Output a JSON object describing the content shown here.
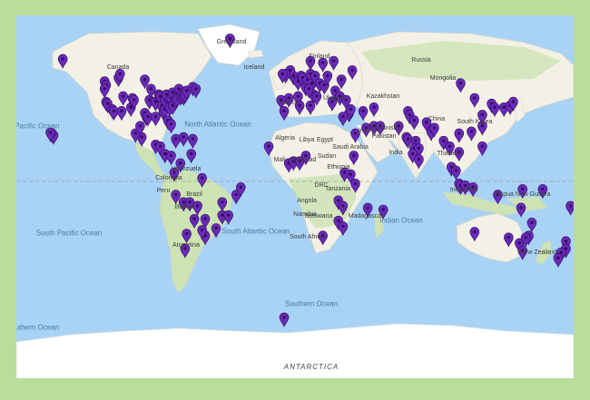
{
  "colors": {
    "frame": "#b9de9a",
    "water": "#a9d3f5",
    "land": "#f3f0e6",
    "green": "#cde3b4",
    "ice": "#ffffff",
    "marker": "#6a29b8"
  },
  "labels": {
    "north_atlantic_ocean": "North Atlantic Ocean",
    "south_atlantic_ocean": "South Atlantic Ocean",
    "north_pacific_ocean": "North Pacific Ocean",
    "south_pacific_ocean": "South Pacific Ocean",
    "indian_ocean": "Indian Ocean",
    "southern_ocean": "Southern Ocean",
    "southern_ocean_left": "Southern Ocean",
    "antarctica": "ANTARCTICA",
    "canada": "Canada",
    "greenland": "Greenland",
    "iceland": "Iceland",
    "finland": "Finland",
    "russia": "Russia",
    "mongolia": "Mongolia",
    "china": "China",
    "south_korea": "South Korea",
    "kazakhstan": "Kazakhstan",
    "ukraine": "Ukraine",
    "france": "France",
    "iran": "Iran",
    "afghanistan": "Afghanistan",
    "pakistan": "Pakistan",
    "india": "India",
    "saudi_arabia": "Saudi Arabia",
    "algeria": "Algeria",
    "libya": "Libya",
    "egypt": "Egypt",
    "mali": "Mali",
    "niger": "Niger",
    "chad": "Chad",
    "sudan": "Sudan",
    "ethiopia": "Ethiopia",
    "drc": "DRC",
    "tanzania": "Tanzania",
    "angola": "Angola",
    "namibia": "Namibia",
    "botswana": "Botswana",
    "south_africa": "South Africa",
    "madagascar": "Madagascar",
    "venezuela": "Venezuela",
    "colombia": "Colombia",
    "peru": "Peru",
    "brazil": "Brazil",
    "bolivia": "Bolivia",
    "argentina": "Argentina",
    "thailand": "Thailand",
    "indonesia": "Indonesia",
    "papua_new_guinea": "Papua New Guinea",
    "new_zealand": "New Zealand"
  },
  "markers": [
    {
      "lon": -150,
      "lat": 61
    },
    {
      "lon": -42,
      "lat": 72
    },
    {
      "lon": -157,
      "lat": 21
    },
    {
      "lon": -156,
      "lat": 20
    },
    {
      "lon": -158,
      "lat": 21.5
    },
    {
      "lon": -123,
      "lat": 49
    },
    {
      "lon": -122,
      "lat": 47
    },
    {
      "lon": -123,
      "lat": 45
    },
    {
      "lon": -122,
      "lat": 38
    },
    {
      "lon": -121,
      "lat": 37
    },
    {
      "lon": -118,
      "lat": 34
    },
    {
      "lon": -117,
      "lat": 33
    },
    {
      "lon": -114,
      "lat": 51
    },
    {
      "lon": -113,
      "lat": 53
    },
    {
      "lon": -112,
      "lat": 33
    },
    {
      "lon": -111,
      "lat": 41
    },
    {
      "lon": -106,
      "lat": 35
    },
    {
      "lon": -105,
      "lat": 40
    },
    {
      "lon": -104,
      "lat": 39
    },
    {
      "lon": -97,
      "lat": 50
    },
    {
      "lon": -97,
      "lat": 32
    },
    {
      "lon": -96,
      "lat": 30
    },
    {
      "lon": -95,
      "lat": 30
    },
    {
      "lon": -94,
      "lat": 39
    },
    {
      "lon": -93,
      "lat": 45
    },
    {
      "lon": -90,
      "lat": 30
    },
    {
      "lon": -90,
      "lat": 38
    },
    {
      "lon": -88,
      "lat": 42
    },
    {
      "lon": -87,
      "lat": 41
    },
    {
      "lon": -86,
      "lat": 36
    },
    {
      "lon": -85,
      "lat": 33
    },
    {
      "lon": -84,
      "lat": 34
    },
    {
      "lon": -84,
      "lat": 39
    },
    {
      "lon": -83,
      "lat": 42
    },
    {
      "lon": -82,
      "lat": 28
    },
    {
      "lon": -81,
      "lat": 35
    },
    {
      "lon": -80,
      "lat": 26
    },
    {
      "lon": -80,
      "lat": 40
    },
    {
      "lon": -79,
      "lat": 43
    },
    {
      "lon": -79,
      "lat": 36
    },
    {
      "lon": -77,
      "lat": 39
    },
    {
      "lon": -76,
      "lat": 40
    },
    {
      "lon": -75,
      "lat": 45
    },
    {
      "lon": -74,
      "lat": 41
    },
    {
      "lon": -73,
      "lat": 42
    },
    {
      "lon": -72,
      "lat": 41
    },
    {
      "lon": -71,
      "lat": 42
    },
    {
      "lon": -70,
      "lat": 44
    },
    {
      "lon": -66,
      "lat": 46
    },
    {
      "lon": -64,
      "lat": 45
    },
    {
      "lon": -99,
      "lat": 19
    },
    {
      "lon": -103,
      "lat": 21
    },
    {
      "lon": -100,
      "lat": 25
    },
    {
      "lon": -90,
      "lat": 15
    },
    {
      "lon": -87,
      "lat": 14
    },
    {
      "lon": -84,
      "lat": 10
    },
    {
      "lon": -80,
      "lat": 9
    },
    {
      "lon": -77,
      "lat": 18
    },
    {
      "lon": -72,
      "lat": 19
    },
    {
      "lon": -66,
      "lat": 18
    },
    {
      "lon": -74,
      "lat": 5
    },
    {
      "lon": -67,
      "lat": 10
    },
    {
      "lon": -78,
      "lat": 0
    },
    {
      "lon": -77,
      "lat": -12
    },
    {
      "lon": -72,
      "lat": -16
    },
    {
      "lon": -68,
      "lat": -16
    },
    {
      "lon": -63,
      "lat": -18
    },
    {
      "lon": -58,
      "lat": -25
    },
    {
      "lon": -58,
      "lat": -34
    },
    {
      "lon": -60,
      "lat": -31
    },
    {
      "lon": -65,
      "lat": -25
    },
    {
      "lon": -70,
      "lat": -33
    },
    {
      "lon": -71,
      "lat": -41
    },
    {
      "lon": -47,
      "lat": -16
    },
    {
      "lon": -47,
      "lat": -23
    },
    {
      "lon": -43,
      "lat": -23
    },
    {
      "lon": -51,
      "lat": -30
    },
    {
      "lon": -38,
      "lat": -12
    },
    {
      "lon": -35,
      "lat": -8
    },
    {
      "lon": -60,
      "lat": -3
    },
    {
      "lon": -1,
      "lat": 52
    },
    {
      "lon": -3,
      "lat": 55
    },
    {
      "lon": -6,
      "lat": 53
    },
    {
      "lon": -8,
      "lat": 53
    },
    {
      "lon": 2,
      "lat": 49
    },
    {
      "lon": 4,
      "lat": 52
    },
    {
      "lon": 5,
      "lat": 51
    },
    {
      "lon": 7,
      "lat": 46
    },
    {
      "lon": 8,
      "lat": 50
    },
    {
      "lon": 10,
      "lat": 53
    },
    {
      "lon": 11,
      "lat": 48
    },
    {
      "lon": 13,
      "lat": 52
    },
    {
      "lon": 12,
      "lat": 42
    },
    {
      "lon": 9,
      "lat": 45
    },
    {
      "lon": 14,
      "lat": 41
    },
    {
      "lon": -4,
      "lat": 40
    },
    {
      "lon": -9,
      "lat": 39
    },
    {
      "lon": 2,
      "lat": 41
    },
    {
      "lon": 16,
      "lat": 48
    },
    {
      "lon": 19,
      "lat": 47
    },
    {
      "lon": 21,
      "lat": 52
    },
    {
      "lon": 18,
      "lat": 59
    },
    {
      "lon": 10,
      "lat": 60
    },
    {
      "lon": 25,
      "lat": 60
    },
    {
      "lon": 24,
      "lat": 38
    },
    {
      "lon": 26,
      "lat": 44
    },
    {
      "lon": 30,
      "lat": 50
    },
    {
      "lon": 37,
      "lat": 55
    },
    {
      "lon": 29,
      "lat": 41
    },
    {
      "lon": 33,
      "lat": 39
    },
    {
      "lon": 35,
      "lat": 32
    },
    {
      "lon": 36,
      "lat": 34
    },
    {
      "lon": 39,
      "lat": 21
    },
    {
      "lon": 46,
      "lat": 24
    },
    {
      "lon": 51,
      "lat": 25
    },
    {
      "lon": 55,
      "lat": 25
    },
    {
      "lon": 51,
      "lat": 35
    },
    {
      "lon": 44,
      "lat": 33
    },
    {
      "lon": -7,
      "lat": 33
    },
    {
      "lon": 3,
      "lat": 36
    },
    {
      "lon": 10,
      "lat": 36
    },
    {
      "lon": 31,
      "lat": 30
    },
    {
      "lon": -17,
      "lat": 14
    },
    {
      "lon": -4,
      "lat": 5
    },
    {
      "lon": -1,
      "lat": 6
    },
    {
      "lon": 3,
      "lat": 6
    },
    {
      "lon": 7,
      "lat": 9
    },
    {
      "lon": 38,
      "lat": 9
    },
    {
      "lon": 36,
      "lat": -1
    },
    {
      "lon": 32,
      "lat": 0
    },
    {
      "lon": 39,
      "lat": -6
    },
    {
      "lon": 28,
      "lat": -15
    },
    {
      "lon": 31,
      "lat": -18
    },
    {
      "lon": 28,
      "lat": -26
    },
    {
      "lon": 18,
      "lat": -34
    },
    {
      "lon": 31,
      "lat": -29
    },
    {
      "lon": 47,
      "lat": -19
    },
    {
      "lon": 57,
      "lat": -20
    },
    {
      "lon": 67,
      "lat": 25
    },
    {
      "lon": 73,
      "lat": 33
    },
    {
      "lon": 74,
      "lat": 31
    },
    {
      "lon": 77,
      "lat": 28
    },
    {
      "lon": 72,
      "lat": 19
    },
    {
      "lon": 73,
      "lat": 18
    },
    {
      "lon": 78,
      "lat": 17
    },
    {
      "lon": 77,
      "lat": 13
    },
    {
      "lon": 80,
      "lat": 13
    },
    {
      "lon": 76,
      "lat": 10
    },
    {
      "lon": 88,
      "lat": 22
    },
    {
      "lon": 85,
      "lat": 27
    },
    {
      "lon": 90,
      "lat": 24
    },
    {
      "lon": 80,
      "lat": 7
    },
    {
      "lon": 96,
      "lat": 17
    },
    {
      "lon": 100,
      "lat": 14
    },
    {
      "lon": 101,
      "lat": 3
    },
    {
      "lon": 104,
      "lat": 1
    },
    {
      "lon": 106,
      "lat": -6
    },
    {
      "lon": 107,
      "lat": -7
    },
    {
      "lon": 110,
      "lat": -7
    },
    {
      "lon": 115,
      "lat": -8
    },
    {
      "lon": 106,
      "lat": 11
    },
    {
      "lon": 106,
      "lat": 21
    },
    {
      "lon": 114,
      "lat": 22
    },
    {
      "lon": 121,
      "lat": 25
    },
    {
      "lon": 121,
      "lat": 31
    },
    {
      "lon": 116,
      "lat": 40
    },
    {
      "lon": 121,
      "lat": 14
    },
    {
      "lon": 127,
      "lat": 37
    },
    {
      "lon": 129,
      "lat": 35
    },
    {
      "lon": 135,
      "lat": 35
    },
    {
      "lon": 139,
      "lat": 36
    },
    {
      "lon": 141,
      "lat": 38
    },
    {
      "lon": 107,
      "lat": 48
    },
    {
      "lon": 147,
      "lat": -9
    },
    {
      "lon": 160,
      "lat": -9
    },
    {
      "lon": 178,
      "lat": -18
    },
    {
      "lon": 116,
      "lat": -32
    },
    {
      "lon": 138,
      "lat": -35
    },
    {
      "lon": 145,
      "lat": -38
    },
    {
      "lon": 151,
      "lat": -34
    },
    {
      "lon": 153,
      "lat": -27
    },
    {
      "lon": 149,
      "lat": -35
    },
    {
      "lon": 147,
      "lat": -42
    },
    {
      "lon": 131,
      "lat": -12
    },
    {
      "lon": 146,
      "lat": -19
    },
    {
      "lon": 175,
      "lat": -37
    },
    {
      "lon": 175,
      "lat": -41
    },
    {
      "lon": 172,
      "lat": -43
    },
    {
      "lon": 170,
      "lat": -46
    },
    {
      "lon": -7,
      "lat": -78
    }
  ]
}
